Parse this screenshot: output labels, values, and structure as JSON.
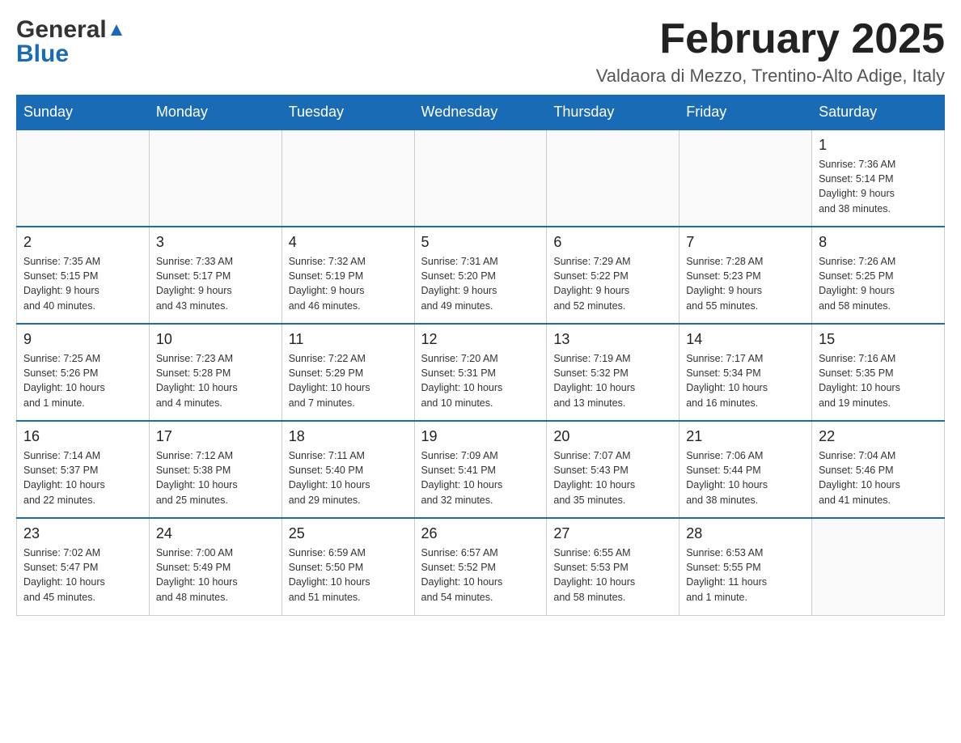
{
  "logo": {
    "text_general": "General",
    "text_blue": "Blue"
  },
  "header": {
    "month_year": "February 2025",
    "location": "Valdaora di Mezzo, Trentino-Alto Adige, Italy"
  },
  "weekdays": [
    "Sunday",
    "Monday",
    "Tuesday",
    "Wednesday",
    "Thursday",
    "Friday",
    "Saturday"
  ],
  "weeks": [
    [
      {
        "day": "",
        "info": ""
      },
      {
        "day": "",
        "info": ""
      },
      {
        "day": "",
        "info": ""
      },
      {
        "day": "",
        "info": ""
      },
      {
        "day": "",
        "info": ""
      },
      {
        "day": "",
        "info": ""
      },
      {
        "day": "1",
        "info": "Sunrise: 7:36 AM\nSunset: 5:14 PM\nDaylight: 9 hours\nand 38 minutes."
      }
    ],
    [
      {
        "day": "2",
        "info": "Sunrise: 7:35 AM\nSunset: 5:15 PM\nDaylight: 9 hours\nand 40 minutes."
      },
      {
        "day": "3",
        "info": "Sunrise: 7:33 AM\nSunset: 5:17 PM\nDaylight: 9 hours\nand 43 minutes."
      },
      {
        "day": "4",
        "info": "Sunrise: 7:32 AM\nSunset: 5:19 PM\nDaylight: 9 hours\nand 46 minutes."
      },
      {
        "day": "5",
        "info": "Sunrise: 7:31 AM\nSunset: 5:20 PM\nDaylight: 9 hours\nand 49 minutes."
      },
      {
        "day": "6",
        "info": "Sunrise: 7:29 AM\nSunset: 5:22 PM\nDaylight: 9 hours\nand 52 minutes."
      },
      {
        "day": "7",
        "info": "Sunrise: 7:28 AM\nSunset: 5:23 PM\nDaylight: 9 hours\nand 55 minutes."
      },
      {
        "day": "8",
        "info": "Sunrise: 7:26 AM\nSunset: 5:25 PM\nDaylight: 9 hours\nand 58 minutes."
      }
    ],
    [
      {
        "day": "9",
        "info": "Sunrise: 7:25 AM\nSunset: 5:26 PM\nDaylight: 10 hours\nand 1 minute."
      },
      {
        "day": "10",
        "info": "Sunrise: 7:23 AM\nSunset: 5:28 PM\nDaylight: 10 hours\nand 4 minutes."
      },
      {
        "day": "11",
        "info": "Sunrise: 7:22 AM\nSunset: 5:29 PM\nDaylight: 10 hours\nand 7 minutes."
      },
      {
        "day": "12",
        "info": "Sunrise: 7:20 AM\nSunset: 5:31 PM\nDaylight: 10 hours\nand 10 minutes."
      },
      {
        "day": "13",
        "info": "Sunrise: 7:19 AM\nSunset: 5:32 PM\nDaylight: 10 hours\nand 13 minutes."
      },
      {
        "day": "14",
        "info": "Sunrise: 7:17 AM\nSunset: 5:34 PM\nDaylight: 10 hours\nand 16 minutes."
      },
      {
        "day": "15",
        "info": "Sunrise: 7:16 AM\nSunset: 5:35 PM\nDaylight: 10 hours\nand 19 minutes."
      }
    ],
    [
      {
        "day": "16",
        "info": "Sunrise: 7:14 AM\nSunset: 5:37 PM\nDaylight: 10 hours\nand 22 minutes."
      },
      {
        "day": "17",
        "info": "Sunrise: 7:12 AM\nSunset: 5:38 PM\nDaylight: 10 hours\nand 25 minutes."
      },
      {
        "day": "18",
        "info": "Sunrise: 7:11 AM\nSunset: 5:40 PM\nDaylight: 10 hours\nand 29 minutes."
      },
      {
        "day": "19",
        "info": "Sunrise: 7:09 AM\nSunset: 5:41 PM\nDaylight: 10 hours\nand 32 minutes."
      },
      {
        "day": "20",
        "info": "Sunrise: 7:07 AM\nSunset: 5:43 PM\nDaylight: 10 hours\nand 35 minutes."
      },
      {
        "day": "21",
        "info": "Sunrise: 7:06 AM\nSunset: 5:44 PM\nDaylight: 10 hours\nand 38 minutes."
      },
      {
        "day": "22",
        "info": "Sunrise: 7:04 AM\nSunset: 5:46 PM\nDaylight: 10 hours\nand 41 minutes."
      }
    ],
    [
      {
        "day": "23",
        "info": "Sunrise: 7:02 AM\nSunset: 5:47 PM\nDaylight: 10 hours\nand 45 minutes."
      },
      {
        "day": "24",
        "info": "Sunrise: 7:00 AM\nSunset: 5:49 PM\nDaylight: 10 hours\nand 48 minutes."
      },
      {
        "day": "25",
        "info": "Sunrise: 6:59 AM\nSunset: 5:50 PM\nDaylight: 10 hours\nand 51 minutes."
      },
      {
        "day": "26",
        "info": "Sunrise: 6:57 AM\nSunset: 5:52 PM\nDaylight: 10 hours\nand 54 minutes."
      },
      {
        "day": "27",
        "info": "Sunrise: 6:55 AM\nSunset: 5:53 PM\nDaylight: 10 hours\nand 58 minutes."
      },
      {
        "day": "28",
        "info": "Sunrise: 6:53 AM\nSunset: 5:55 PM\nDaylight: 11 hours\nand 1 minute."
      },
      {
        "day": "",
        "info": ""
      }
    ]
  ]
}
